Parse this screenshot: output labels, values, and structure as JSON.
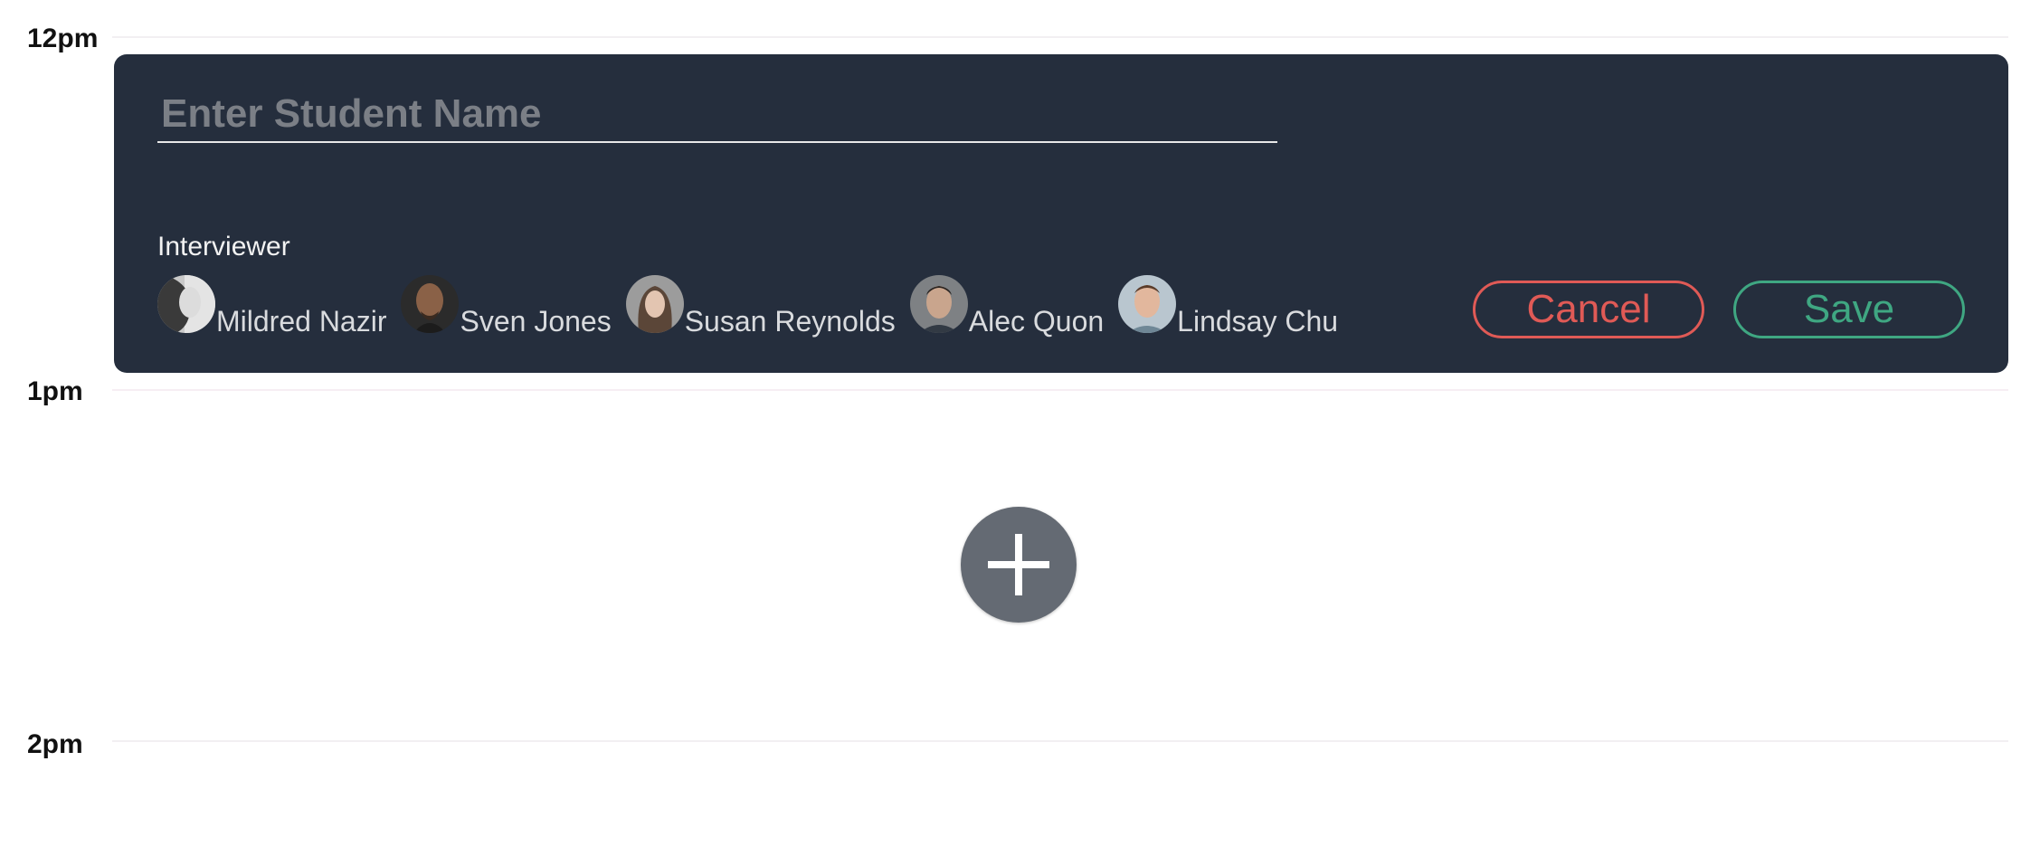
{
  "times": {
    "t12": "12pm",
    "t1": "1pm",
    "t2": "2pm"
  },
  "form": {
    "student_name_placeholder": "Enter Student Name",
    "student_name_value": "",
    "interviewer_label": "Interviewer",
    "interviewers": [
      {
        "name": "Mildred Nazir",
        "avatar": "person-photo-icon"
      },
      {
        "name": "Sven Jones",
        "avatar": "person-photo-icon"
      },
      {
        "name": "Susan Reynolds",
        "avatar": "person-photo-icon"
      },
      {
        "name": "Alec Quon",
        "avatar": "person-photo-icon"
      },
      {
        "name": "Lindsay Chu",
        "avatar": "person-photo-icon"
      }
    ],
    "cancel_label": "Cancel",
    "save_label": "Save"
  },
  "add_button": {
    "icon": "plus-icon"
  },
  "colors": {
    "card_background": "#252e3d",
    "cancel": "#e05a56",
    "save": "#3fa782",
    "add_button": "#646a73"
  }
}
